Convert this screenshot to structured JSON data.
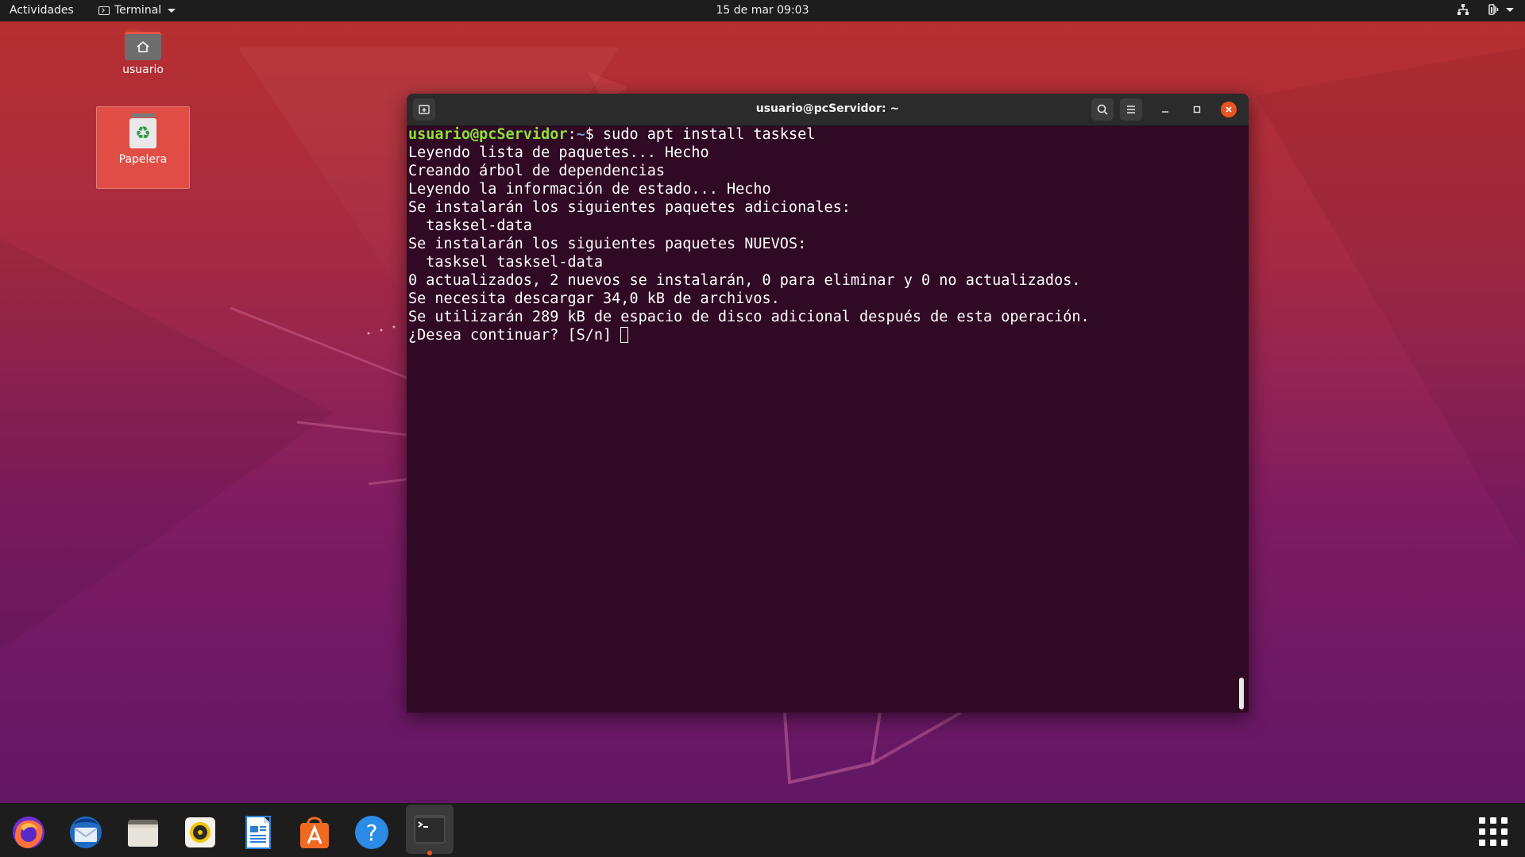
{
  "topbar": {
    "activities": "Actividades",
    "app_name": "Terminal",
    "clock": "15 de mar  09:03"
  },
  "desktop": {
    "icons": [
      {
        "label": "usuario",
        "icon": "home-folder-icon"
      },
      {
        "label": "Papelera",
        "icon": "trash-icon"
      }
    ]
  },
  "terminal": {
    "title": "usuario@pcServidor: ~",
    "prompt_user": "usuario@pcServidor",
    "prompt_sep": ":",
    "prompt_path": "~",
    "prompt_symbol": "$ ",
    "command": "sudo apt install tasksel",
    "output": [
      "Leyendo lista de paquetes... Hecho",
      "Creando árbol de dependencias",
      "Leyendo la información de estado... Hecho",
      "Se instalarán los siguientes paquetes adicionales:",
      "  tasksel-data",
      "Se instalarán los siguientes paquetes NUEVOS:",
      "  tasksel tasksel-data",
      "0 actualizados, 2 nuevos se instalarán, 0 para eliminar y 0 no actualizados.",
      "Se necesita descargar 34,0 kB de archivos.",
      "Se utilizarán 289 kB de espacio de disco adicional después de esta operación."
    ],
    "last_prompt": "¿Desea continuar? [S/n] "
  },
  "dock": {
    "apps": [
      {
        "name": "firefox-icon",
        "color": "#ff7139"
      },
      {
        "name": "thunderbird-icon",
        "color": "#2a7fd4"
      },
      {
        "name": "files-icon",
        "color": "#d8d4cc"
      },
      {
        "name": "rhythmbox-icon",
        "color": "#f2c400"
      },
      {
        "name": "libreoffice-writer-icon",
        "color": "#2a7fd4"
      },
      {
        "name": "ubuntu-software-icon",
        "color": "#f06a22"
      },
      {
        "name": "help-icon",
        "color": "#2b8be6"
      },
      {
        "name": "terminal-icon",
        "color": "#333333"
      }
    ]
  },
  "colors": {
    "accent": "#e95420",
    "terminal_bg": "#300a24",
    "prompt_user": "#8ae234",
    "prompt_path": "#729fcf"
  }
}
